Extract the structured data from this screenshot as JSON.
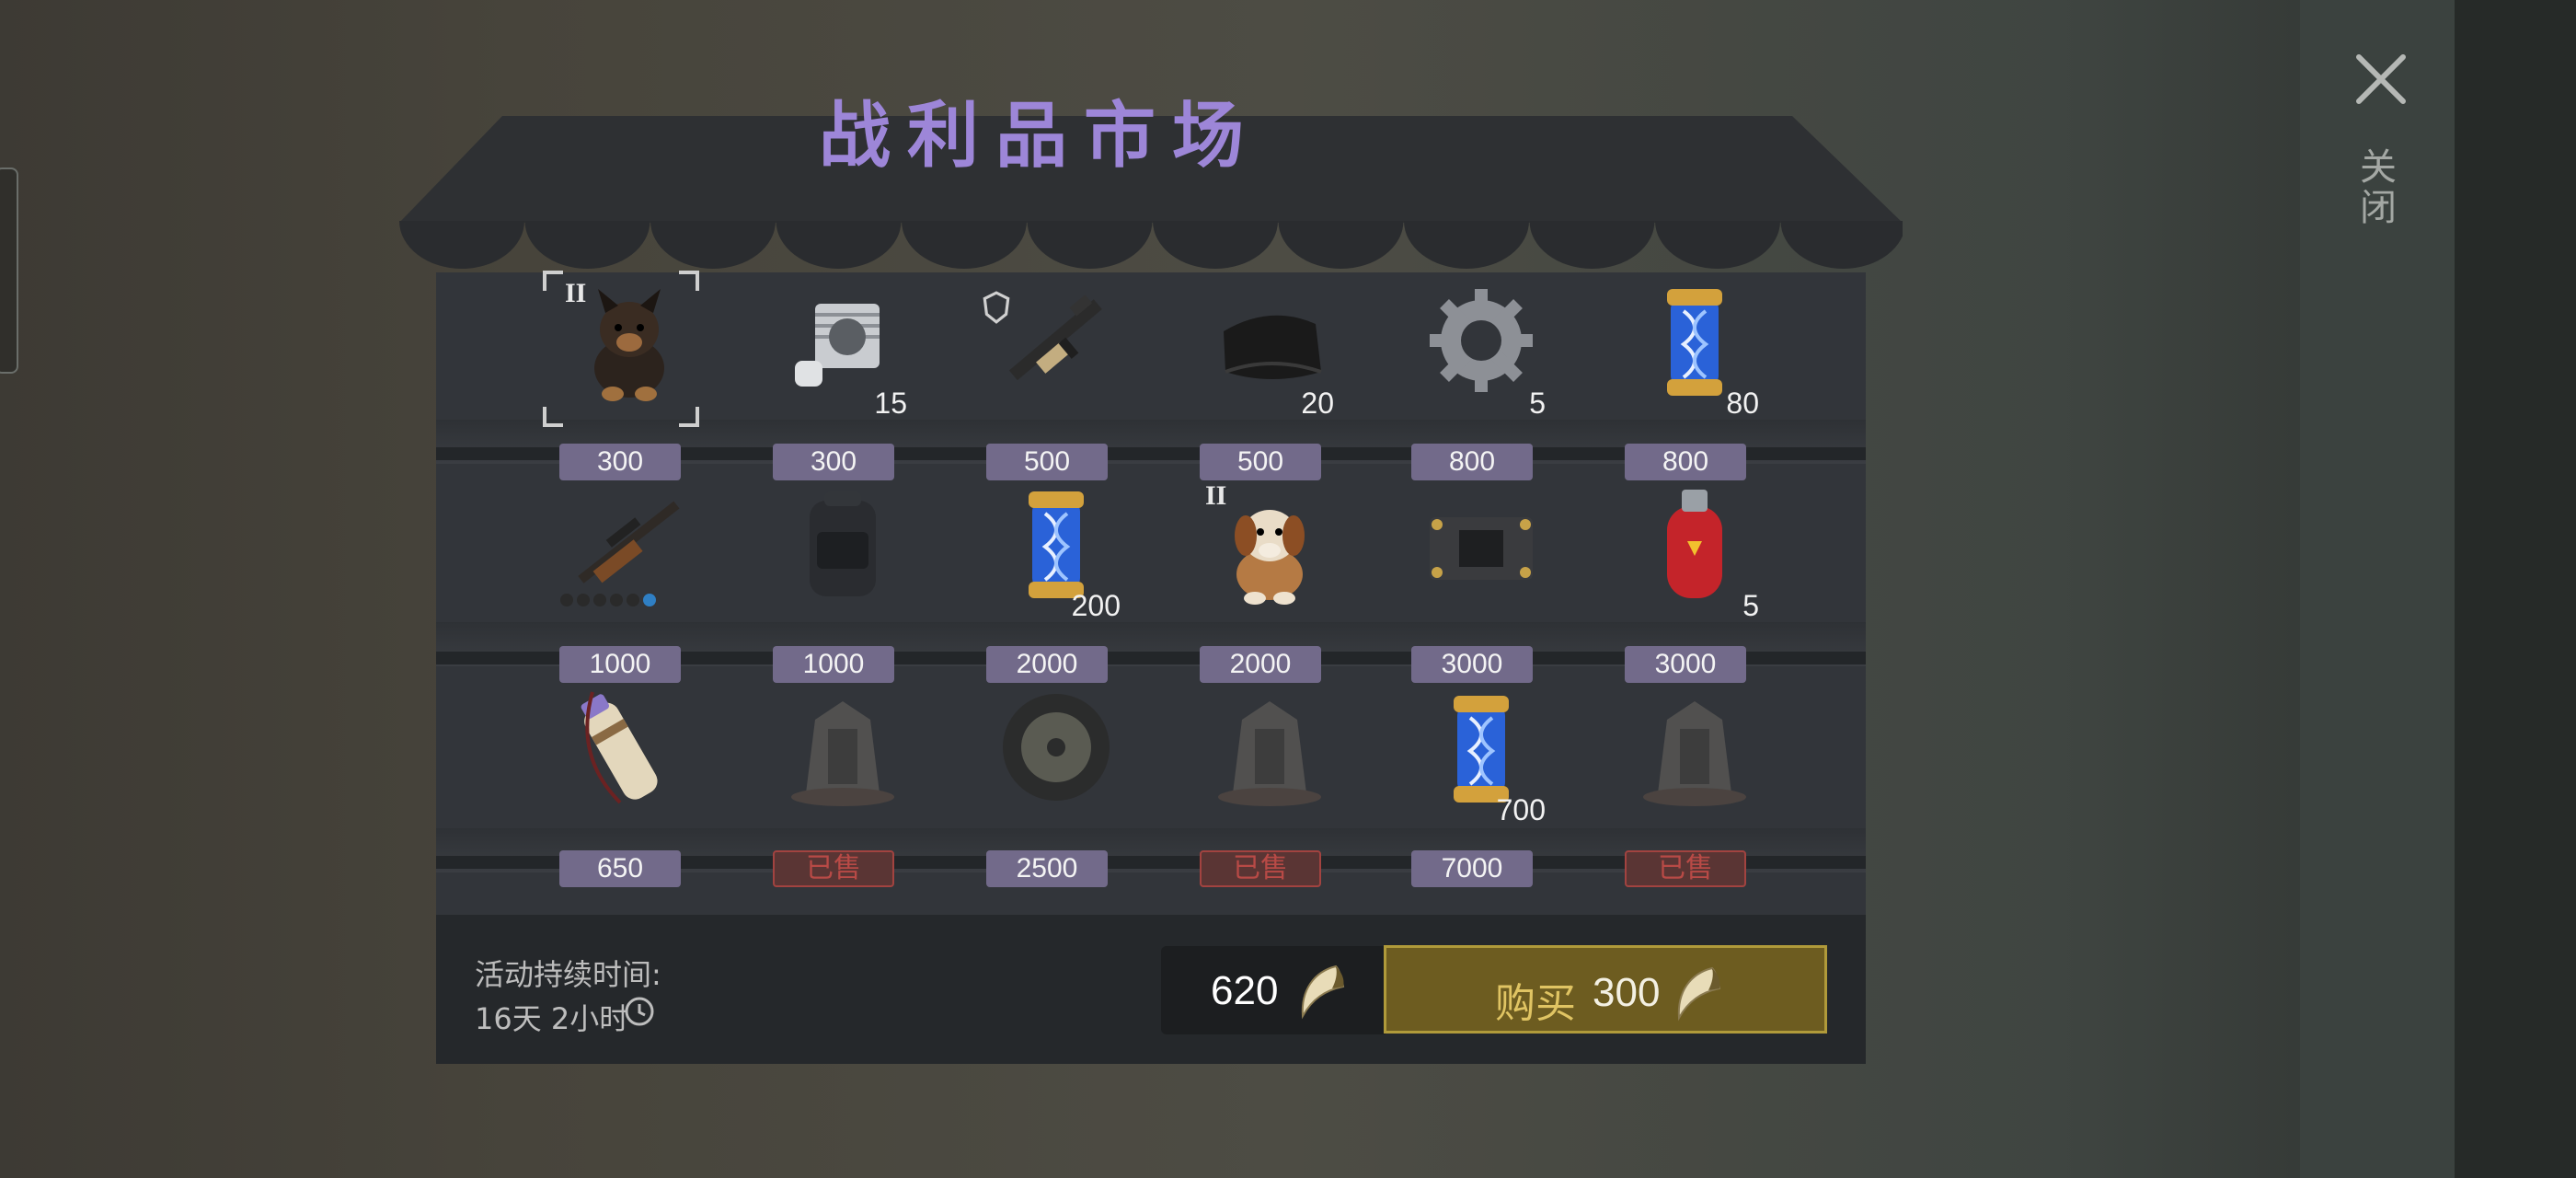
{
  "title": "战利品市场",
  "close_label": "关闭",
  "grid": [
    [
      {
        "icon": "puppy-black-icon",
        "tier": "II",
        "qty": "",
        "price": "300",
        "sold": false,
        "selected": true
      },
      {
        "icon": "engine-cylinder-icon",
        "tier": "",
        "qty": "15",
        "price": "300",
        "sold": false
      },
      {
        "icon": "assault-rifle-icon",
        "tier": "",
        "qty": "",
        "price": "500",
        "sold": false,
        "badge": "shield-badge-icon"
      },
      {
        "icon": "fabric-icon",
        "tier": "",
        "qty": "20",
        "price": "500",
        "sold": false
      },
      {
        "icon": "gear-icon",
        "tier": "",
        "qty": "5",
        "price": "800",
        "sold": false
      },
      {
        "icon": "dna-capsule-icon",
        "tier": "",
        "qty": "80",
        "price": "800",
        "sold": false
      }
    ],
    [
      {
        "icon": "sniper-rifle-icon",
        "tier": "",
        "qty": "",
        "price": "1000",
        "sold": false,
        "dots": true
      },
      {
        "icon": "backpack-icon",
        "tier": "",
        "qty": "",
        "price": "1000",
        "sold": false
      },
      {
        "icon": "dna-capsule-icon",
        "tier": "",
        "qty": "200",
        "price": "2000",
        "sold": false
      },
      {
        "icon": "puppy-brown-icon",
        "tier": "II",
        "qty": "",
        "price": "2000",
        "sold": false
      },
      {
        "icon": "circuit-board-icon",
        "tier": "",
        "qty": "",
        "price": "3000",
        "sold": false
      },
      {
        "icon": "gas-cylinder-icon",
        "tier": "",
        "qty": "5",
        "price": "3000",
        "sold": false
      }
    ],
    [
      {
        "icon": "scroll-case-icon",
        "tier": "",
        "qty": "",
        "price": "650",
        "sold": false
      },
      {
        "icon": "ruined-machine-icon",
        "tier": "",
        "qty": "",
        "price": "已售",
        "sold": true
      },
      {
        "icon": "wheel-icon",
        "tier": "",
        "qty": "",
        "price": "2500",
        "sold": false
      },
      {
        "icon": "ruined-machine-icon",
        "tier": "",
        "qty": "",
        "price": "已售",
        "sold": true
      },
      {
        "icon": "dna-capsule-icon",
        "tier": "",
        "qty": "700",
        "price": "7000",
        "sold": false
      },
      {
        "icon": "ruined-machine-icon",
        "tier": "",
        "qty": "",
        "price": "已售",
        "sold": true
      }
    ]
  ],
  "footer": {
    "duration_label": "活动持续时间:",
    "duration_value": "16天 2小时",
    "balance": "620",
    "buy_label": "购买",
    "buy_price": "300"
  },
  "colors": {
    "title": "#9d86d8",
    "price_tag": "#726a8a",
    "sold_tag": "#a24340",
    "buy_button": "#6d5c20"
  }
}
